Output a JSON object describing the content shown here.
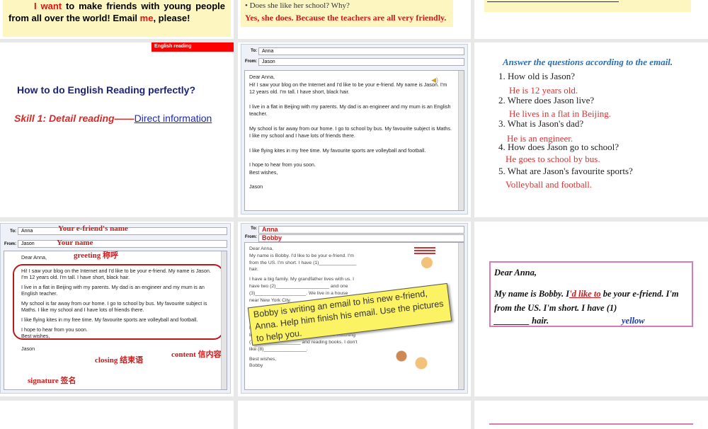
{
  "slides": {
    "s0a": {
      "pre": "I ",
      "want": "want",
      "mid": " to make friends with young people from all over the world! Email ",
      "me": "me",
      "post": ", please!"
    },
    "s0b": {
      "question": "• Does she like her school? Why?",
      "answer": "Yes, she does. Because the teachers are all very friendly."
    },
    "s1a": {
      "tag": "English reading",
      "title": "How to do English Reading perfectly?",
      "skill": "Skill 1: Detail reading——",
      "link": "Direct information"
    },
    "email": {
      "to_label": "To:",
      "from_label": "From:",
      "to": "Anna",
      "from": "Jason",
      "greeting": "Dear Anna,",
      "p1": "Hi! I saw your blog on the Internet and I'd like to be your e-friend. My name is Jason. I'm 12 years old. I'm tall. I have short, black hair.",
      "p2": "I live in a flat in Beijing with my parents. My dad is an engineer and my mum is an English teacher.",
      "p3": "My school is far away from our home. I go to school by bus. My favourite subject is Maths. I like my school and I have lots of friends there.",
      "p4": "I like flying kites in my free time. My favourite sports are volleyball and football.",
      "p5": "I hope to hear from you soon.",
      "closing": "Best wishes,",
      "signature": "Jason"
    },
    "s1c": {
      "heading": "Answer the questions according to the email.",
      "qa": [
        {
          "q": "1. How old is Jason?",
          "a": "He is 12 years old."
        },
        {
          "q": "2. Where does Jason live?",
          "a": "He lives in a flat in Beijing."
        },
        {
          "q": "3. What is Jason's dad?",
          "a": "He is an engineer."
        },
        {
          "q": "4. How does Jason go to school?",
          "a": "He goes to school by bus."
        },
        {
          "q": "5. What are Jason's favourite sports?",
          "a": "Volleyball and football."
        }
      ]
    },
    "s2a": {
      "ann_to": "Your e-friend's name",
      "ann_from": "Your name",
      "ann_greeting": "greeting  称呼",
      "ann_content": "content  信内容",
      "ann_closing": "closing  结束语",
      "ann_signature": "signature  签名"
    },
    "s2b": {
      "to": "Anna",
      "from": "Bobby",
      "greeting": "Dear Anna,",
      "l1": "My name is Bobby. I'd like  to be your e-friend. I'm from the US. I'm short. I have (1)______________ hair.",
      "l2": "I have a big family. My grandfather lives with us. I have two (2)____________________ and one (3)___________________. We live in a house near New York City.",
      "l3": "My favourite sport is (6)____________________. I like swimming too. My other hobbies are watching (7)_________________ and reading books. I don't like (8)________________.",
      "closing": "Best wishes,",
      "signature": "Bobby",
      "callout": "Bobby is writing an email to his new e-friend, Anna. Help him finish his email. Use the pictures to help you."
    },
    "s2c": {
      "greeting": "Dear Anna,",
      "l1a": "My name is Bobby. I",
      "l1b": "'d like to",
      "l1c": " be your e-friend. I'm from the US. I'm short. I have (1)",
      "blank": "________",
      "hair": " hair.",
      "answer": "yellow"
    }
  }
}
